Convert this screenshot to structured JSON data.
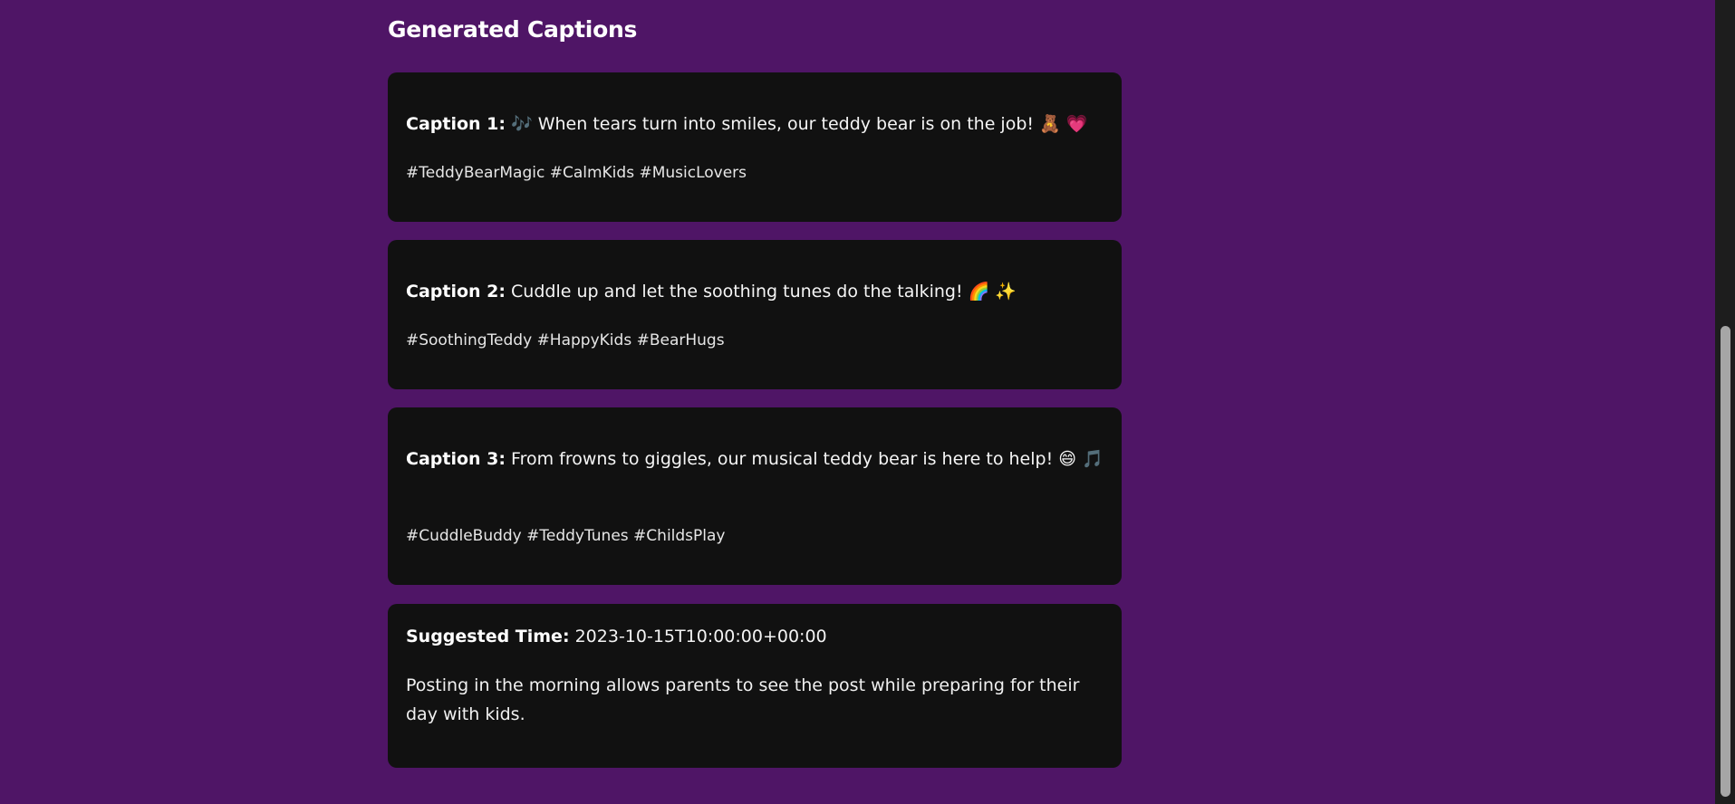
{
  "section": {
    "title": "Generated Captions"
  },
  "captions": [
    {
      "label": "Caption 1:",
      "text": "🎶 When tears turn into smiles, our teddy bear is on the job! 🧸 💗",
      "hashtags": "#TeddyBearMagic #CalmKids #MusicLovers"
    },
    {
      "label": "Caption 2:",
      "text": "Cuddle up and let the soothing tunes do the talking! 🌈 ✨",
      "hashtags": "#SoothingTeddy #HappyKids #BearHugs"
    },
    {
      "label": "Caption 3:",
      "text": "From frowns to giggles, our musical teddy bear is here to help! 😄 🎵",
      "hashtags": "#CuddleBuddy #TeddyTunes #ChildsPlay"
    }
  ],
  "suggestion": {
    "label": "Suggested Time:",
    "time": "2023-10-15T10:00:00+00:00",
    "reason": "Posting in the morning allows parents to see the post while preparing for their day with kids."
  },
  "colors": {
    "background": "#4f1566",
    "card": "#111111",
    "text": "#f3f3f3"
  }
}
